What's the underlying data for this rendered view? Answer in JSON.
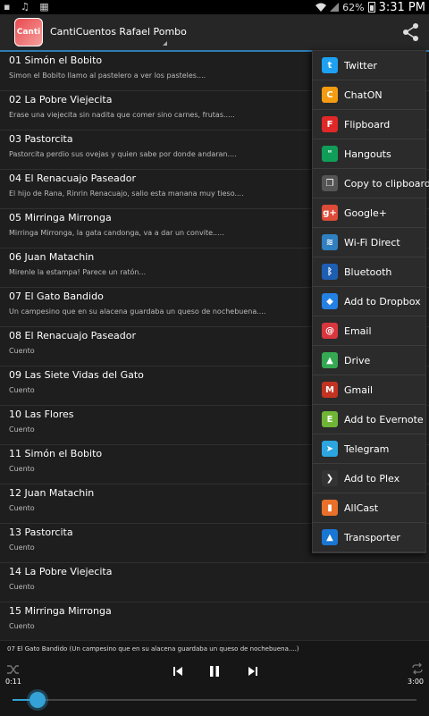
{
  "status": {
    "battery": "62%",
    "time": "3:31 PM",
    "left_icons": "▪ ♫ ▦"
  },
  "app": {
    "title": "CantiCuentos Rafael Pombo",
    "icon_text": "Canti"
  },
  "list": [
    {
      "title": "01 Simón el Bobito",
      "subtitle": "Simon el Bobito llamo al pastelero a ver los pasteles...."
    },
    {
      "title": "02 La Pobre Viejecita",
      "subtitle": "Erase una viejecita sin nadita que comer sino carnes, frutas....."
    },
    {
      "title": "03 Pastorcita",
      "subtitle": "Pastorcita perdio sus ovejas y quien sabe por donde andaran...."
    },
    {
      "title": "04 El Renacuajo Paseador",
      "subtitle": "El hijo de Rana, Rinrin Renacuajo, salio esta manana muy tieso...."
    },
    {
      "title": "05 Mirringa Mirronga",
      "subtitle": "Mirringa Mirronga, la gata candonga, va a dar un convite....."
    },
    {
      "title": "06 Juan Matachin",
      "subtitle": "Mirenle la estampa! Parece un ratón..."
    },
    {
      "title": "07 El Gato Bandido",
      "subtitle": "Un campesino que en su alacena guardaba un queso de nochebuena...."
    },
    {
      "title": "08 El Renacuajo Paseador",
      "subtitle": "Cuento"
    },
    {
      "title": "09 Las Siete Vidas del Gato",
      "subtitle": "Cuento"
    },
    {
      "title": "10 Las Flores",
      "subtitle": "Cuento"
    },
    {
      "title": "11 Simón el Bobito",
      "subtitle": "Cuento"
    },
    {
      "title": "12 Juan Matachin",
      "subtitle": "Cuento"
    },
    {
      "title": "13 Pastorcita",
      "subtitle": "Cuento"
    },
    {
      "title": "14 La Pobre Viejecita",
      "subtitle": "Cuento"
    },
    {
      "title": "15 Mirringa Mirronga",
      "subtitle": "Cuento"
    }
  ],
  "player": {
    "now_playing": "07 El Gato Bandido (Un campesino que en su alacena guardaba un queso de nochebuena....)",
    "elapsed": "0:11",
    "duration": "3:00",
    "progress": 0.061
  },
  "share_menu": [
    {
      "label": "Twitter",
      "icon": "twitter-icon",
      "color": "#1da1f2",
      "glyph": "t"
    },
    {
      "label": "ChatON",
      "icon": "chaton-icon",
      "color": "#f39c12",
      "glyph": "C"
    },
    {
      "label": "Flipboard",
      "icon": "flipboard-icon",
      "color": "#e12828",
      "glyph": "F"
    },
    {
      "label": "Hangouts",
      "icon": "hangouts-icon",
      "color": "#0f9d58",
      "glyph": "\""
    },
    {
      "label": "Copy to clipboard",
      "icon": "clipboard-icon",
      "color": "#555555",
      "glyph": "❐"
    },
    {
      "label": "Google+",
      "icon": "google-plus-icon",
      "color": "#dd4b39",
      "glyph": "g+"
    },
    {
      "label": "Wi-Fi Direct",
      "icon": "wifi-direct-icon",
      "color": "#2f7fc1",
      "glyph": "≋"
    },
    {
      "label": "Bluetooth",
      "icon": "bluetooth-icon",
      "color": "#1e5fb3",
      "glyph": "ᛒ"
    },
    {
      "label": "Add to Dropbox",
      "icon": "dropbox-icon",
      "color": "#2481e4",
      "glyph": "◆"
    },
    {
      "label": "Email",
      "icon": "email-icon",
      "color": "#d9363e",
      "glyph": "@"
    },
    {
      "label": "Drive",
      "icon": "drive-icon",
      "color": "#34a853",
      "glyph": "▲"
    },
    {
      "label": "Gmail",
      "icon": "gmail-icon",
      "color": "#c23321",
      "glyph": "M"
    },
    {
      "label": "Add to Evernote",
      "icon": "evernote-icon",
      "color": "#6fb536",
      "glyph": "E"
    },
    {
      "label": "Telegram",
      "icon": "telegram-icon",
      "color": "#2ca5e0",
      "glyph": "➤"
    },
    {
      "label": "Add to Plex",
      "icon": "plex-icon",
      "color": "#333333",
      "glyph": "❯"
    },
    {
      "label": "AllCast",
      "icon": "allcast-icon",
      "color": "#e8702a",
      "glyph": "▮"
    },
    {
      "label": "Transporter",
      "icon": "transporter-icon",
      "color": "#1976d2",
      "glyph": "▲"
    }
  ]
}
